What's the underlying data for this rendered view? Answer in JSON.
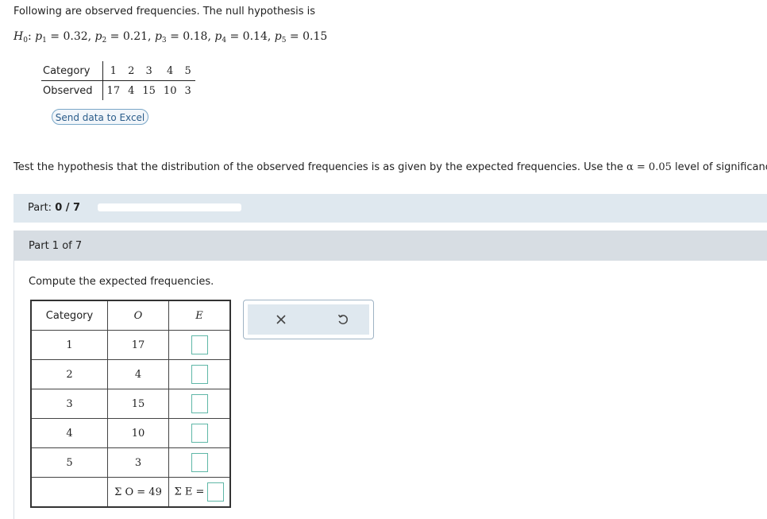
{
  "intro": "Following are observed frequencies. The null hypothesis is",
  "hypothesis": {
    "h_label": "H",
    "h_sub": "0",
    "colon": ": ",
    "terms": [
      {
        "p": "p",
        "sub": "1",
        "eq": " = 0.32, "
      },
      {
        "p": "p",
        "sub": "2",
        "eq": " = 0.21, "
      },
      {
        "p": "p",
        "sub": "3",
        "eq": " = 0.18, "
      },
      {
        "p": "p",
        "sub": "4",
        "eq": " = 0.14, "
      },
      {
        "p": "p",
        "sub": "5",
        "eq": " = 0.15"
      }
    ]
  },
  "observed_table": {
    "category_label": "Category",
    "observed_label": "Observed",
    "categories": [
      "1",
      "2",
      "3",
      "4",
      "5"
    ],
    "observed": [
      "17",
      "4",
      "15",
      "10",
      "3"
    ]
  },
  "excel_button": "Send data to Excel",
  "instruction": {
    "text_before": "Test the hypothesis that the distribution of the observed frequencies is as given by the expected frequencies. Use the ",
    "alpha": "α = 0.05",
    "text_after": " level of significance."
  },
  "progress": {
    "label": "Part: ",
    "value": "0 / 7",
    "fraction": 0
  },
  "part_header": "Part 1 of 7",
  "question": "Compute the expected frequencies.",
  "expected_table": {
    "headers": {
      "category": "Category",
      "o": "O",
      "e": "E"
    },
    "rows": [
      {
        "category": "1",
        "o": "17"
      },
      {
        "category": "2",
        "o": "4"
      },
      {
        "category": "3",
        "o": "15"
      },
      {
        "category": "4",
        "o": "10"
      },
      {
        "category": "5",
        "o": "3"
      }
    ],
    "sum_o": "Σ O = 49",
    "sum_e": "Σ E ="
  },
  "icons": {
    "clear": "x-icon",
    "undo": "undo-icon"
  },
  "colors": {
    "bar_bg": "#dfe8ef",
    "part_bg": "#d7dde3",
    "input_border": "#5fb7a7"
  }
}
